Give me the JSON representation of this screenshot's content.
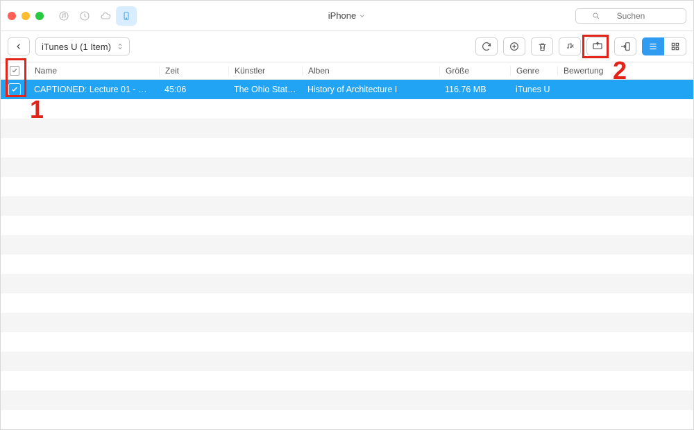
{
  "window": {
    "title": "iPhone"
  },
  "search": {
    "placeholder": "Suchen"
  },
  "toolbar": {
    "dropdown": "iTunes U (1 Item)"
  },
  "columns": {
    "name": "Name",
    "time": "Zeit",
    "artist": "Künstler",
    "album": "Alben",
    "size": "Größe",
    "genre": "Genre",
    "rating": "Bewertung"
  },
  "rows": [
    {
      "selected": true,
      "name": "CAPTIONED: Lecture 01 - Wh…",
      "time": "45:06",
      "artist": "The Ohio State…",
      "album": "History of Architecture I",
      "size": "116.76 MB",
      "genre": "iTunes U",
      "rating": ""
    }
  ],
  "annotations": {
    "label1": "1",
    "label2": "2"
  }
}
